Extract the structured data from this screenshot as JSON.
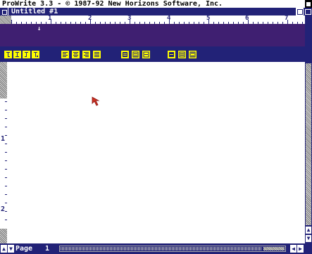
{
  "screen": {
    "title": "ProWrite 3.3 - © 1987-92 New Horizons Software, Inc."
  },
  "window": {
    "title": "Untitled #1"
  },
  "ruler": {
    "numbers": [
      "1",
      "2",
      "3",
      "4",
      "5",
      "6",
      "7"
    ]
  },
  "vruler": {
    "numbers": [
      "1",
      "2"
    ]
  },
  "tabs": {
    "marker": "↓"
  },
  "status": {
    "page_label": "Page",
    "page_number": "1"
  },
  "colors": {
    "window_blue": "#222277",
    "tab_band": "#3f1f71",
    "toolbar_icon": "#ffff00",
    "pointer": "#cc3322"
  },
  "icons": [
    "close-icon",
    "zoom-icon",
    "depth-icon",
    "pointer-icon",
    "scroll-up-icon",
    "scroll-down-icon",
    "scroll-left-icon",
    "scroll-right-icon"
  ]
}
